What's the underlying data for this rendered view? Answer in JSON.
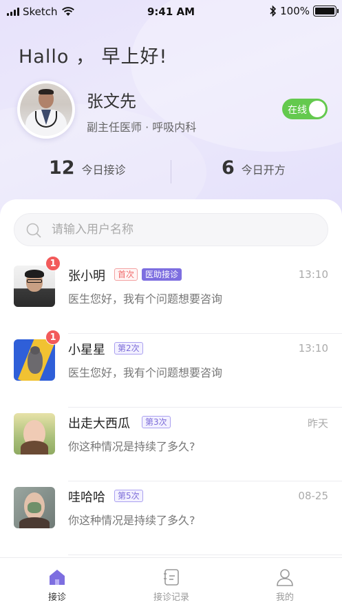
{
  "status_bar": {
    "carrier": "Sketch",
    "time": "9:41 AM",
    "battery": "100%"
  },
  "greeting": "Hallo ， 早上好!",
  "doctor": {
    "name": "张文先",
    "title": "副主任医师 · 呼吸内科"
  },
  "online_toggle": {
    "label": "在线",
    "on": true
  },
  "stats": [
    {
      "value": "12",
      "label": "今日接诊"
    },
    {
      "value": "6",
      "label": "今日开方"
    }
  ],
  "search": {
    "placeholder": "请输入用户名称",
    "value": ""
  },
  "conversations": [
    {
      "name": "张小明",
      "tags": [
        "首次",
        "医助接诊"
      ],
      "time": "13:10",
      "message": "医生您好，我有个问题想要咨询",
      "unread": "1"
    },
    {
      "name": "小星星",
      "tags": [
        "第2次"
      ],
      "time": "13:10",
      "message": "医生您好，我有个问题想要咨询",
      "unread": "1"
    },
    {
      "name": "出走大西瓜",
      "tags": [
        "第3次"
      ],
      "time": "昨天",
      "message": "你这种情况是持续了多久?",
      "unread": ""
    },
    {
      "name": "哇哈哈",
      "tags": [
        "第5次"
      ],
      "time": "08-25",
      "message": "你这种情况是持续了多久?",
      "unread": ""
    }
  ],
  "tabs": [
    {
      "label": "接诊",
      "icon": "home-icon",
      "active": true
    },
    {
      "label": "接诊记录",
      "icon": "record-icon",
      "active": false
    },
    {
      "label": "我的",
      "icon": "user-icon",
      "active": false
    }
  ],
  "colors": {
    "accent": "#7d6ee0",
    "online": "#64c94e",
    "badge": "#f25a5a"
  }
}
